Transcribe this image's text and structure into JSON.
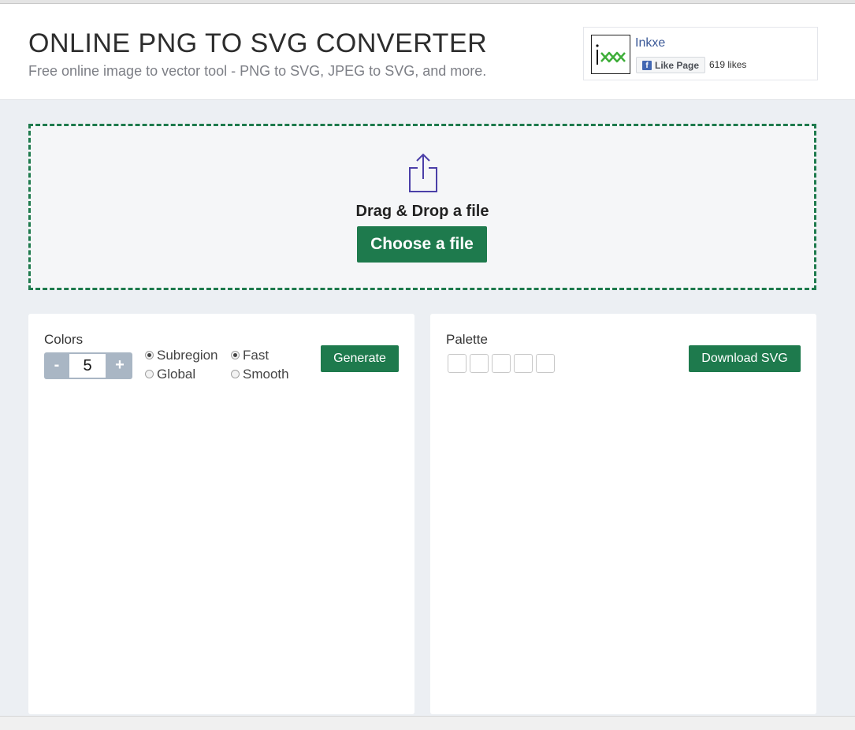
{
  "header": {
    "title": "ONLINE PNG TO SVG CONVERTER",
    "subtitle": "Free online image to vector tool - PNG to SVG, JPEG to SVG, and more."
  },
  "facebook": {
    "page_name": "Inkxe",
    "like_label": "Like Page",
    "likes": "619 likes",
    "like_icon": "facebook-f-icon",
    "logo_icon": "inkxe-logo"
  },
  "dropzone": {
    "icon": "upload-share-icon",
    "text": "Drag & Drop a file",
    "button_label": "Choose a file"
  },
  "settings": {
    "colors_label": "Colors",
    "minus_label": "-",
    "plus_label": "+",
    "colors_value": "5",
    "options": {
      "subregion": "Subregion",
      "global": "Global",
      "fast": "Fast",
      "smooth": "Smooth"
    },
    "selected": [
      "Subregion",
      "Fast"
    ],
    "generate_label": "Generate"
  },
  "palette": {
    "label": "Palette",
    "swatch_count": 5,
    "download_label": "Download SVG"
  },
  "colors": {
    "accent_green": "#1e7a4d",
    "stepper_gray": "#a9b6c4",
    "background": "#eceff3",
    "icon_purple": "#4b3fa8",
    "facebook_blue": "#3b5998"
  }
}
